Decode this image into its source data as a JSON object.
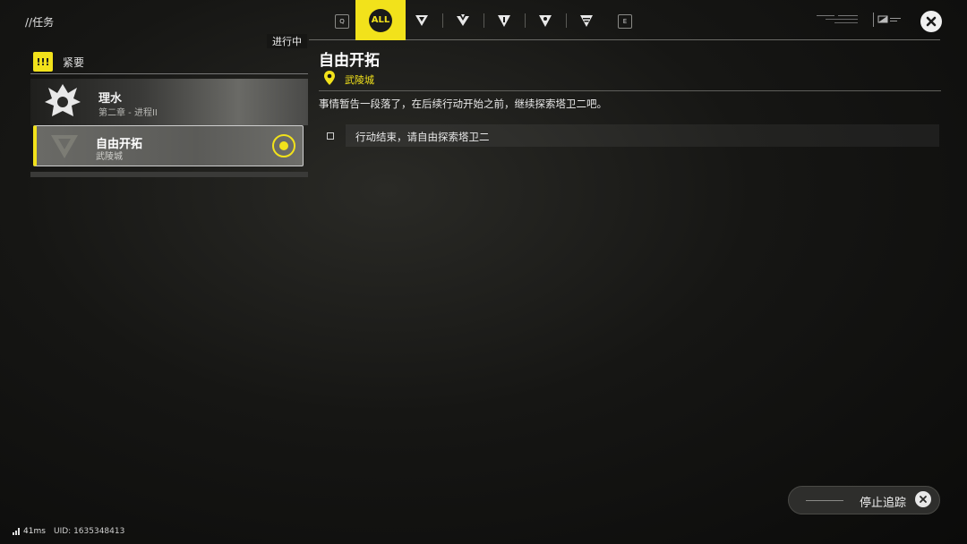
{
  "header": {
    "breadcrumb": "//任务",
    "tab_prev_key": "Q",
    "tab_next_key": "E",
    "tabs": [
      {
        "label": "ALL",
        "icon": "all-tab",
        "active": true
      },
      {
        "icon": "v-emblem-icon"
      },
      {
        "icon": "arrow-emblem-icon"
      },
      {
        "icon": "triangle-bar-icon"
      },
      {
        "icon": "triangle-star-icon"
      },
      {
        "icon": "triangle-lines-icon"
      }
    ],
    "close_icon": "close-icon"
  },
  "left_panel": {
    "status_label": "进行中",
    "group": {
      "icon": "urgent-icon",
      "icon_text": "!!!",
      "label": "紧要"
    },
    "quests": [
      {
        "title": "理水",
        "subtitle": "第二章 - 进程II",
        "selected": false
      },
      {
        "title": "自由开拓",
        "subtitle": "武陵城",
        "selected": true,
        "tracked": true
      }
    ]
  },
  "detail": {
    "title": "自由开拓",
    "location": "武陵城",
    "description": "事情暂告一段落了，在后续行动开始之前，继续探索塔卫二吧。",
    "objectives": [
      {
        "text": "行动结束，请自由探索塔卫二",
        "done": false
      }
    ]
  },
  "stop_tracking": {
    "label": "停止追踪"
  },
  "footer": {
    "ping": "41ms",
    "uid": "UID: 1635348413"
  },
  "colors": {
    "accent": "#f2e21b",
    "background": "#161614"
  }
}
